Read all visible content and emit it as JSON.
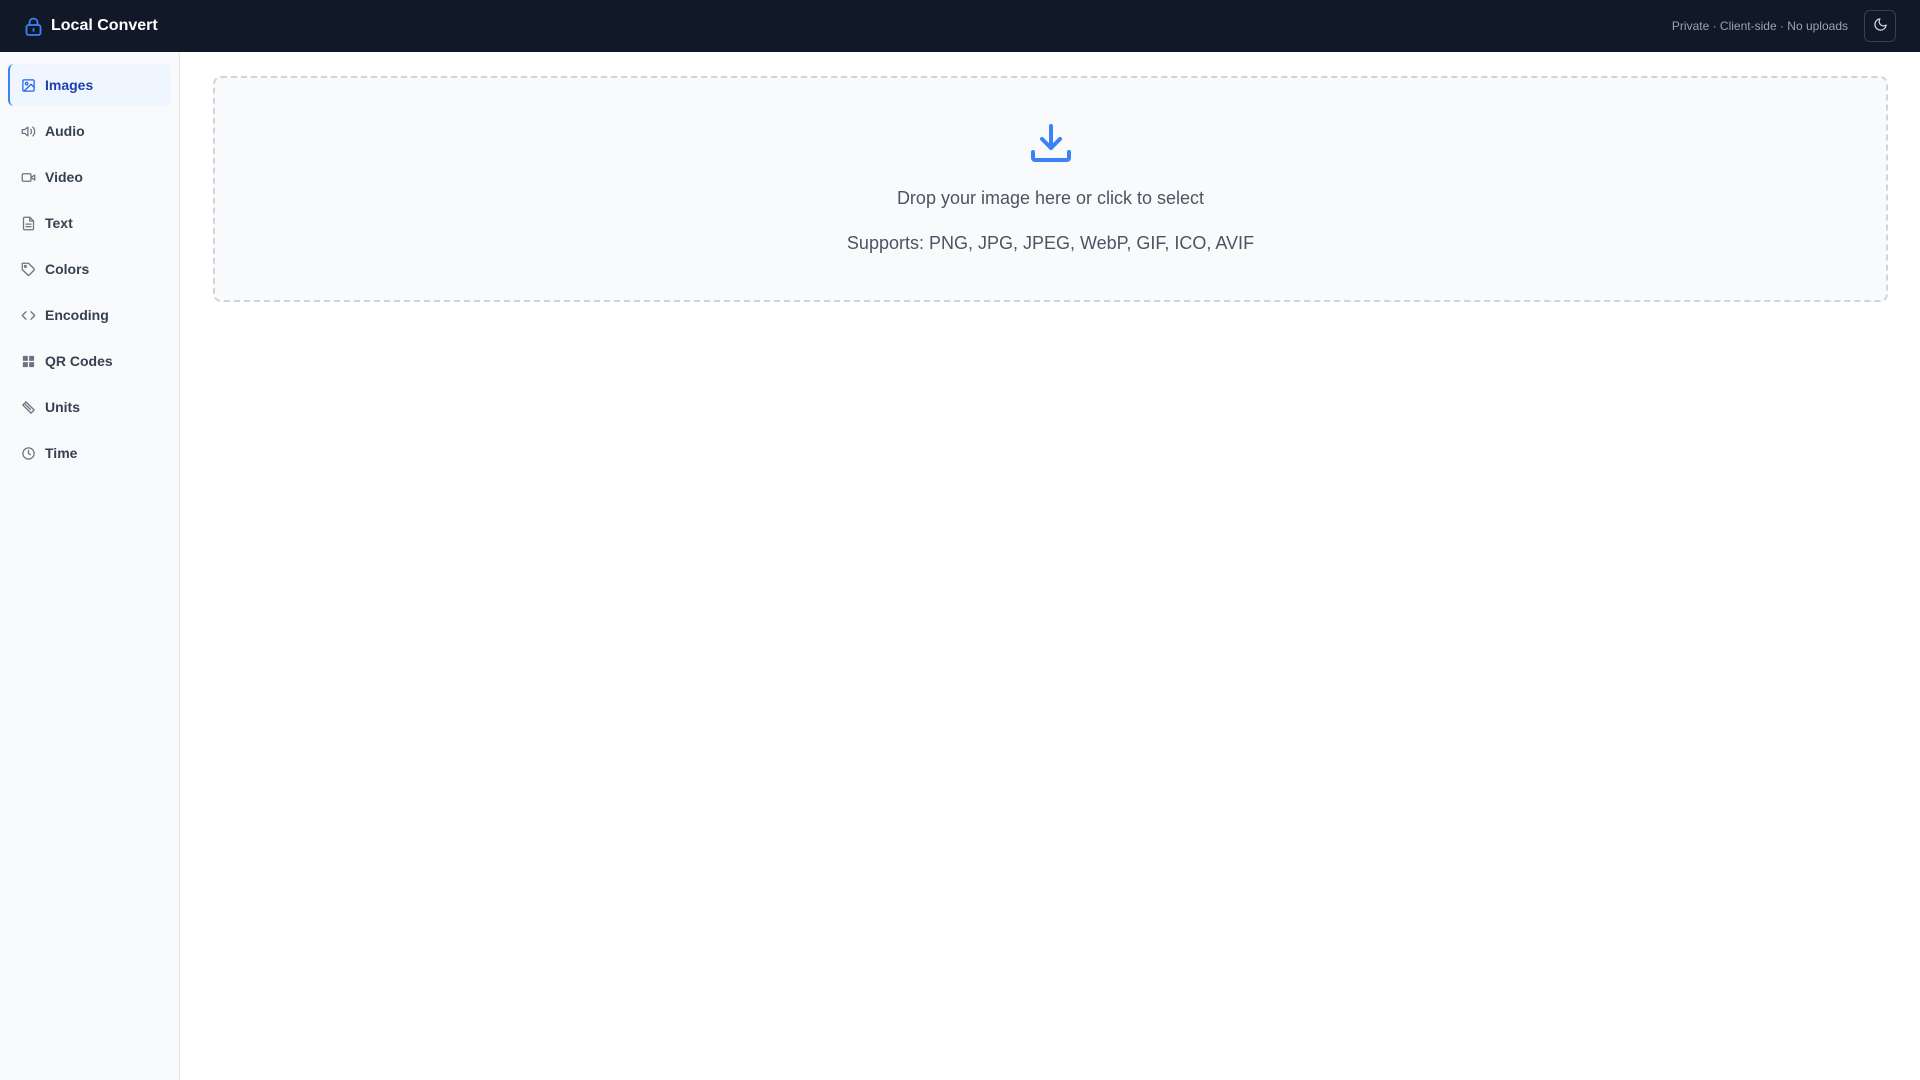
{
  "header": {
    "title": "Local Convert",
    "tagline": "Private · Client-side · No uploads",
    "brand_icon": "lock-icon",
    "theme_icon": "moon-icon"
  },
  "sidebar": {
    "items": [
      {
        "label": "Images",
        "icon": "image-icon",
        "active": true
      },
      {
        "label": "Audio",
        "icon": "speaker-icon"
      },
      {
        "label": "Video",
        "icon": "video-icon"
      },
      {
        "label": "Text",
        "icon": "document-icon"
      },
      {
        "label": "Colors",
        "icon": "tag-icon"
      },
      {
        "label": "Encoding",
        "icon": "code-icon"
      },
      {
        "label": "QR Codes",
        "icon": "grid-icon"
      },
      {
        "label": "Units",
        "icon": "ruler-icon"
      },
      {
        "label": "Time",
        "icon": "clock-icon"
      }
    ]
  },
  "dropzone": {
    "icon": "download-icon",
    "title": "Drop your image here or click to select",
    "supports": "Supports: PNG, JPG, JPEG, WebP, GIF, ICO, AVIF"
  },
  "colors": {
    "topbar": "#111827",
    "accent": "#3b82f6",
    "active_text": "#1e40af"
  }
}
